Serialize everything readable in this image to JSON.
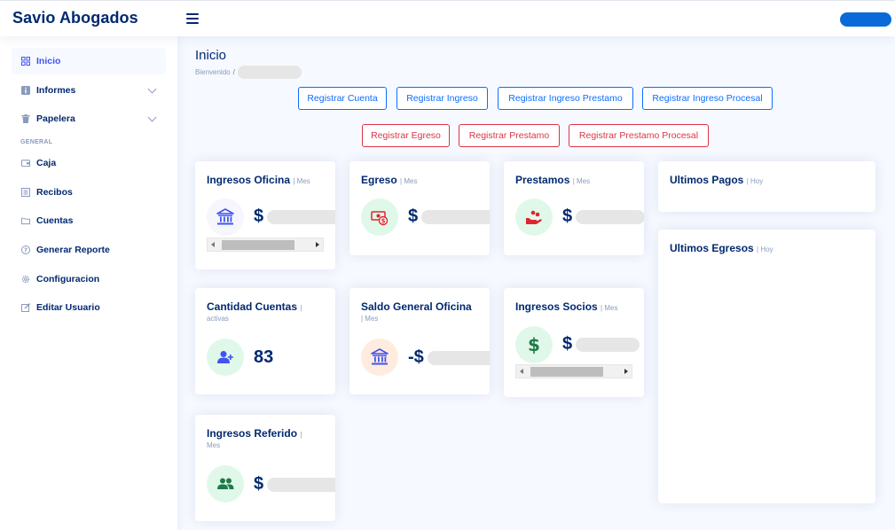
{
  "header": {
    "brand": "Savio Abogados"
  },
  "sidebar": {
    "items": [
      {
        "label": "Inicio",
        "icon": "grid-icon"
      },
      {
        "label": "Informes",
        "icon": "info-icon"
      },
      {
        "label": "Papelera",
        "icon": "trash-icon"
      },
      {
        "label": "Caja",
        "icon": "wallet-icon"
      },
      {
        "label": "Recibos",
        "icon": "receipt-icon"
      },
      {
        "label": "Cuentas",
        "icon": "folder-icon"
      },
      {
        "label": "Generar Reporte",
        "icon": "question-icon"
      },
      {
        "label": "Configuracion",
        "icon": "gear-icon"
      },
      {
        "label": "Editar Usuario",
        "icon": "edit-icon"
      }
    ],
    "heading_general": "GENERAL"
  },
  "page": {
    "title": "Inicio",
    "breadcrumb_home": "Bienvenido",
    "breadcrumb_sep": "/"
  },
  "actions": {
    "registrar_cuenta": "Registrar Cuenta",
    "registrar_ingreso": "Registrar Ingreso",
    "registrar_ingreso_prestamo": "Registrar Ingreso Prestamo",
    "registrar_ingreso_procesal": "Registrar Ingreso Procesal",
    "registrar_egreso": "Registrar Egreso",
    "registrar_prestamo": "Registrar Prestamo",
    "registrar_prestamo_procesal": "Registrar Prestamo Procesal"
  },
  "cards": {
    "ingresos_oficina": {
      "title": "Ingresos Oficina",
      "period": "| Mes",
      "currency": "$"
    },
    "egreso": {
      "title": "Egreso",
      "period": "| Mes",
      "currency": "$"
    },
    "prestamos": {
      "title": "Prestamos",
      "period": "| Mes",
      "currency": "$"
    },
    "ultimos_pagos": {
      "title": "Ultimos Pagos",
      "period": "| Hoy"
    },
    "ultimos_egresos": {
      "title": "Ultimos Egresos",
      "period": "| Hoy"
    },
    "cantidad_cuentas": {
      "title": "Cantidad Cuentas",
      "period": "|",
      "sub": "activas",
      "value": "83"
    },
    "saldo_general": {
      "title": "Saldo General Oficina",
      "sub": "| Mes",
      "currency": "-$"
    },
    "ingresos_socios": {
      "title": "Ingresos Socios",
      "period": "| Mes",
      "currency": "$"
    },
    "ingresos_referido": {
      "title": "Ingresos Referido",
      "period": "|",
      "sub": "Mes",
      "currency": "$"
    }
  },
  "colors": {
    "brand": "#012970",
    "primary": "#0d6efd",
    "danger": "#dc3545",
    "accent_blue": "#4154f1",
    "accent_green": "#2eca6a",
    "user_pill": "#0a6ad8"
  }
}
